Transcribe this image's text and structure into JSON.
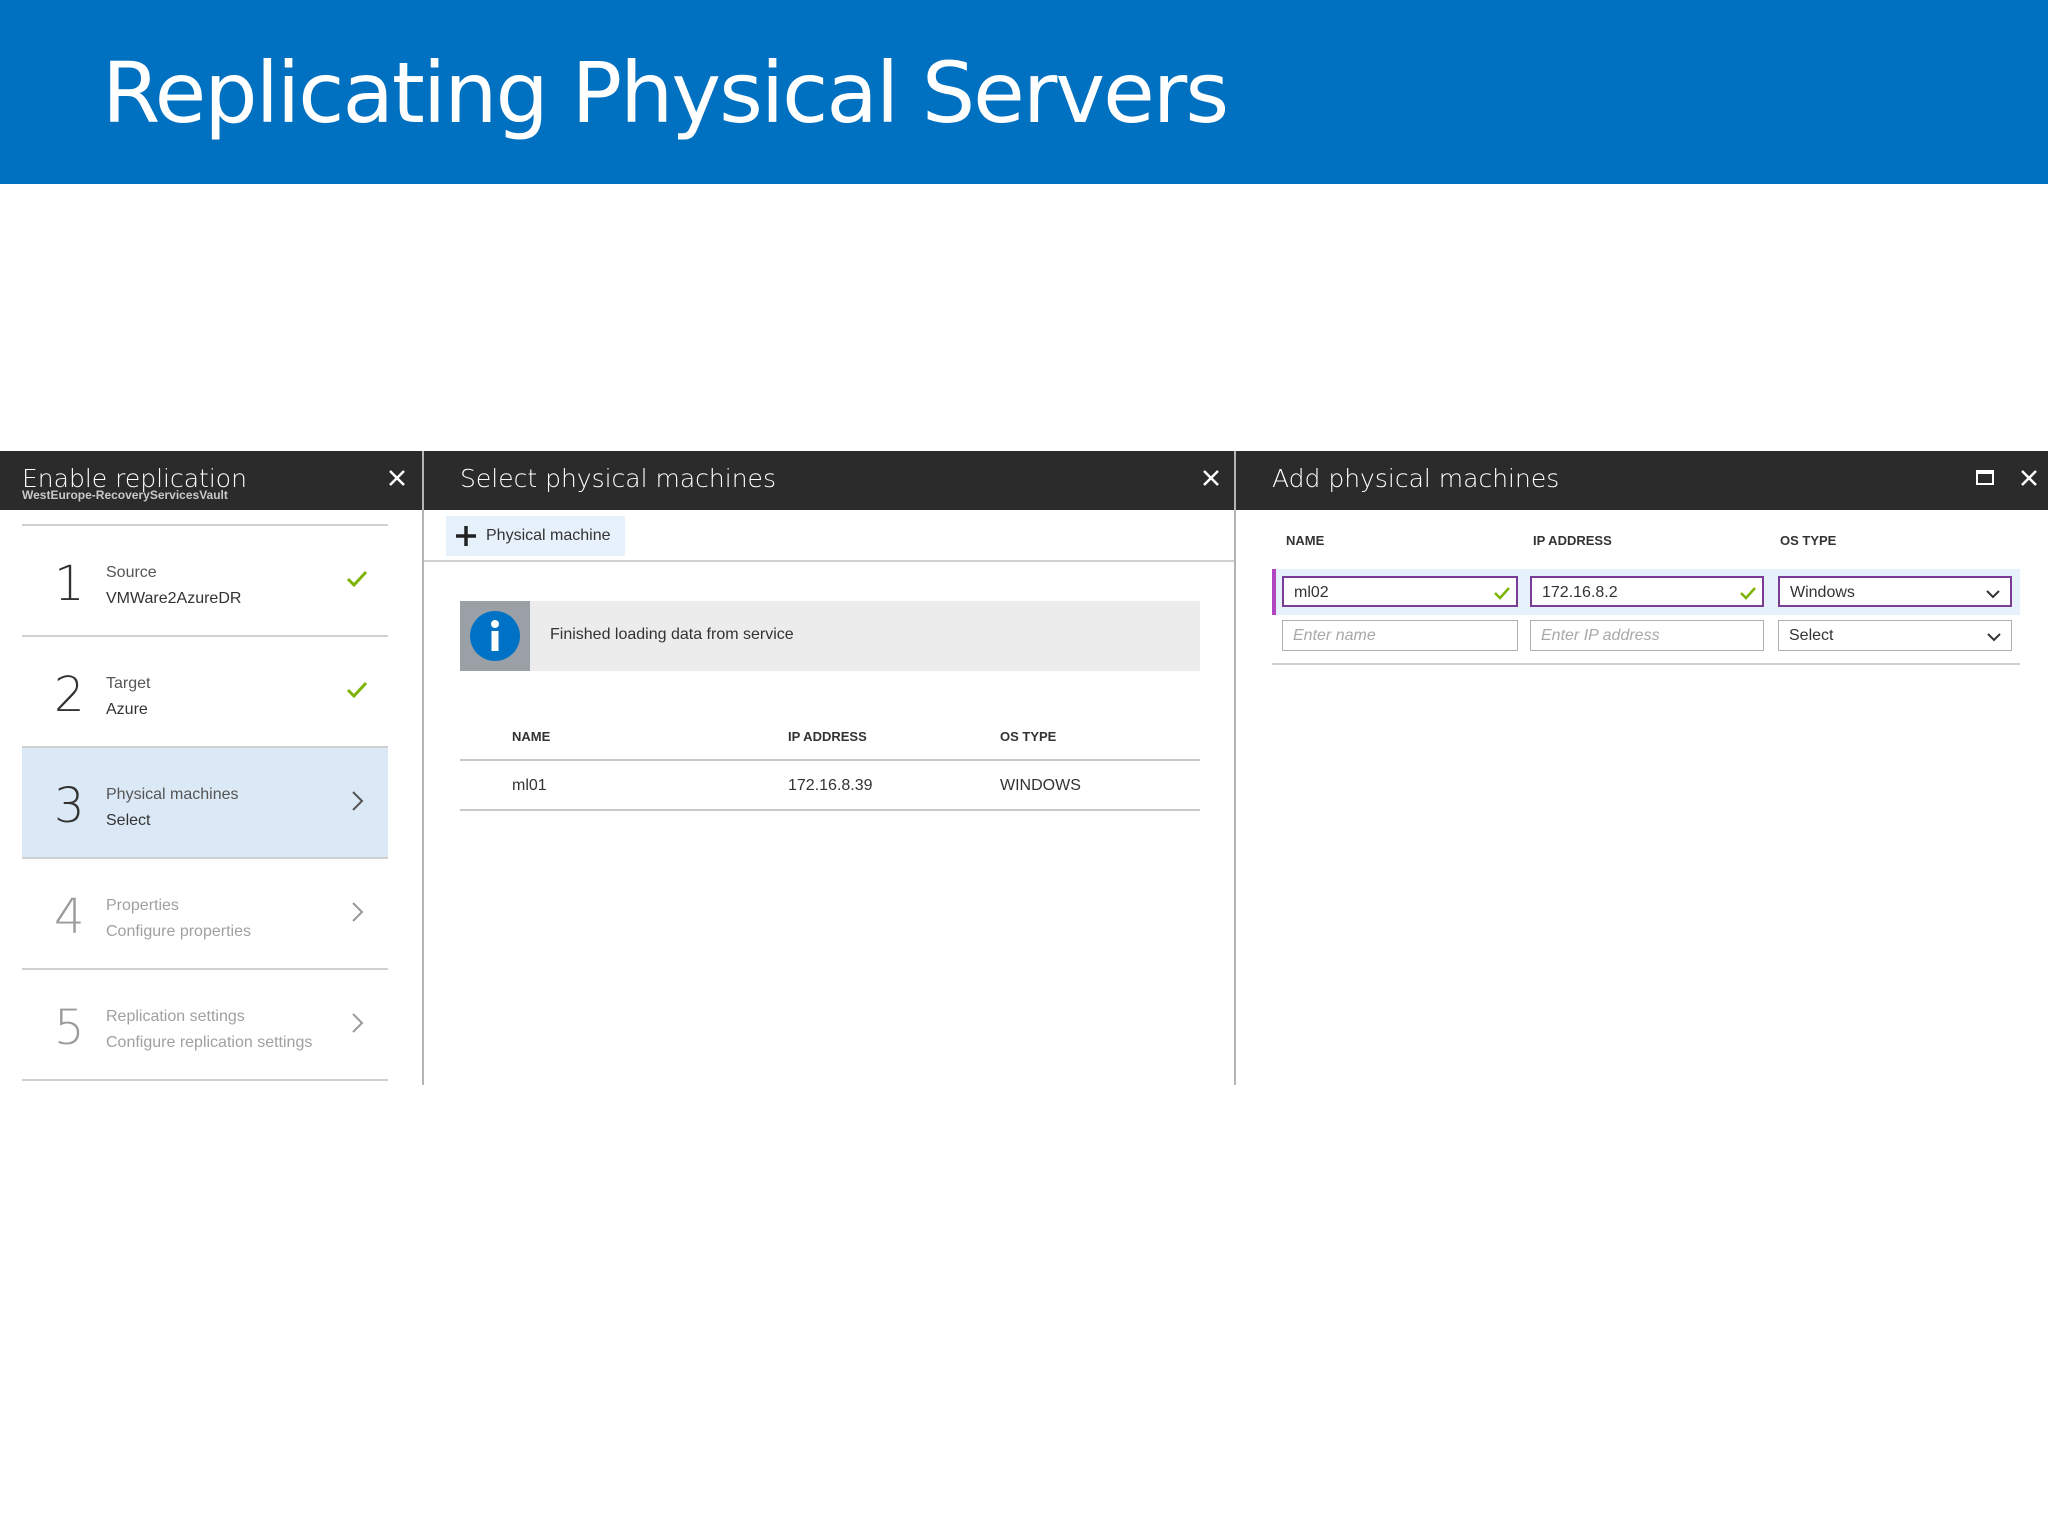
{
  "banner": {
    "title": "Replicating Physical Servers"
  },
  "colors": {
    "banner": "#0070c0",
    "blade_header": "#2b2b2b",
    "check": "#7cb305",
    "active_step": "#dbe8f5",
    "info_icon": "#0072c6",
    "focus_border": "#b146c2"
  },
  "blade_enable": {
    "title": "Enable replication",
    "subtitle": "WestEurope-RecoveryServicesVault",
    "close_icon": "close-icon",
    "steps": [
      {
        "number": "1",
        "title": "Source",
        "value": "VMWare2AzureDR",
        "status": "complete"
      },
      {
        "number": "2",
        "title": "Target",
        "value": "Azure",
        "status": "complete"
      },
      {
        "number": "3",
        "title": "Physical machines",
        "value": "Select",
        "status": "active"
      },
      {
        "number": "4",
        "title": "Properties",
        "value": "Configure properties",
        "status": "disabled"
      },
      {
        "number": "5",
        "title": "Replication settings",
        "value": "Configure replication settings",
        "status": "disabled"
      }
    ]
  },
  "blade_select": {
    "title": "Select physical machines",
    "close_icon": "close-icon",
    "add_button": "Physical machine",
    "info_message": "Finished loading data from service",
    "columns": [
      "NAME",
      "IP ADDRESS",
      "OS TYPE"
    ],
    "rows": [
      {
        "name": "ml01",
        "ip": "172.16.8.39",
        "os": "WINDOWS"
      }
    ]
  },
  "blade_add": {
    "title": "Add physical machines",
    "columns": [
      "NAME",
      "IP ADDRESS",
      "OS TYPE"
    ],
    "row1": {
      "name": "ml02",
      "ip": "172.16.8.2",
      "os": "Windows"
    },
    "row2": {
      "name_placeholder": "Enter name",
      "ip_placeholder": "Enter IP address",
      "os": "Select"
    }
  }
}
